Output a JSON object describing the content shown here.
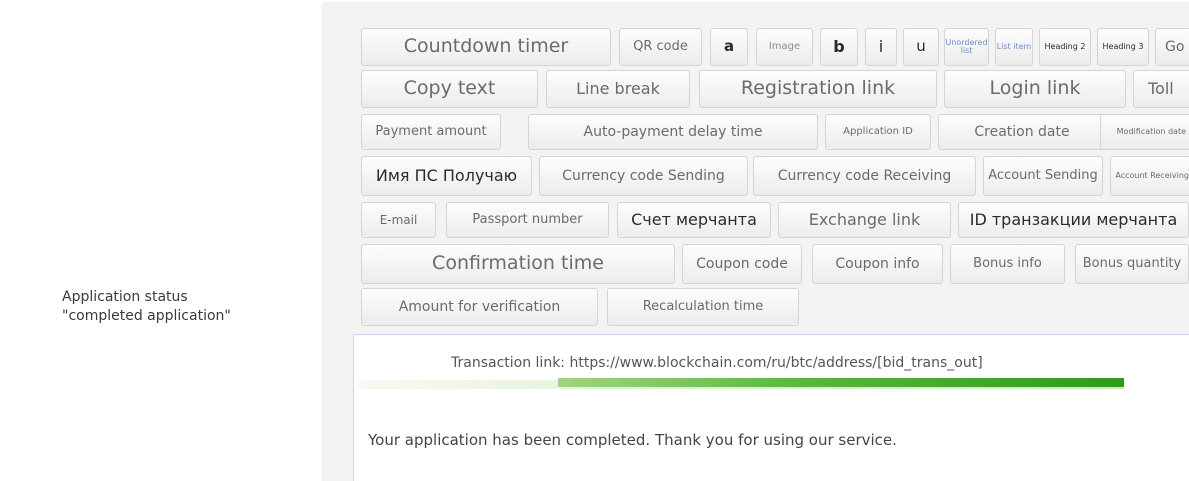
{
  "side_label": {
    "line1": "Application status",
    "line2": "\"completed application\""
  },
  "toolbar": {
    "countdown_timer": "Countdown timer",
    "qr_code": "QR code",
    "a": "a",
    "image": "Image",
    "b": "b",
    "i": "i",
    "u": "u",
    "unordered_list": "Unordered list",
    "list_item": "List item",
    "heading2": "Heading 2",
    "heading3": "Heading 3",
    "go": "Go",
    "copy_text": "Copy text",
    "line_break": "Line break",
    "registration_link": "Registration link",
    "login_link": "Login link",
    "toll": "Toll",
    "payment_amount": "Payment amount",
    "auto_payment_delay": "Auto-payment delay time",
    "application_id": "Application ID",
    "creation_date": "Creation date",
    "modification_date": "Modification date",
    "ps_name_receive": "Имя ПС Получаю",
    "currency_code_sending": "Currency code Sending",
    "currency_code_receiving": "Currency code Receiving",
    "account_sending": "Account Sending",
    "account_receiving": "Account Receiving",
    "email": "E-mail",
    "passport_number": "Passport number",
    "merchant_account": "Счет мерчанта",
    "exchange_link": "Exchange link",
    "merchant_tx_id": "ID транзакции мерчанта",
    "confirmation_time": "Confirmation time",
    "coupon_code": "Coupon code",
    "coupon_info": "Coupon info",
    "bonus_info": "Bonus info",
    "bonus_quantity": "Bonus quantity",
    "amount_for_verification": "Amount for verification",
    "recalculation_time": "Recalculation time"
  },
  "editor": {
    "transaction_link": "Transaction link: https://www.blockchain.com/ru/btc/address/[bid_trans_out]",
    "message": "Your application has been completed. Thank you for using our service."
  }
}
